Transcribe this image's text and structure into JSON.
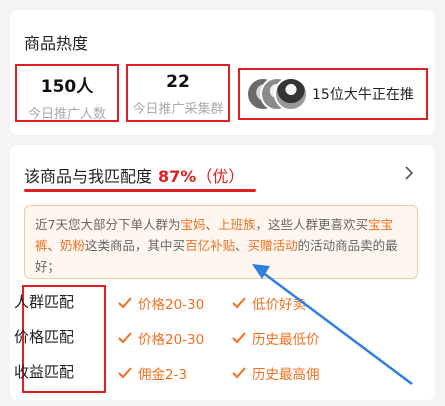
{
  "heat": {
    "title": "商品热度",
    "stats": [
      {
        "value": "150人",
        "label": "今日推广人数"
      },
      {
        "value": "22",
        "label": "今日推广采集群"
      }
    ],
    "influencer_text": "15位大牛正在推"
  },
  "match": {
    "title": "该商品与我匹配度",
    "percent": "87%",
    "rating": "（优）",
    "insight": {
      "t1": "近7天您大部分下单人群为",
      "h1": "宝妈",
      "t2": "、",
      "h2": "上班族",
      "t3": "，这些人群更喜欢买",
      "h3": "宝宝裤",
      "t4": "、",
      "h4": "奶粉",
      "t5": "这类商品，其中买",
      "h5": "百亿补贴",
      "t6": "、",
      "h6": "买赠活动",
      "t7": "的活动商品卖的最好；"
    },
    "rows": [
      {
        "label": "人群匹配",
        "tags": [
          "价格20-30",
          "低价好卖"
        ]
      },
      {
        "label": "价格匹配",
        "tags": [
          "价格20-30",
          "历史最低价"
        ]
      },
      {
        "label": "收益匹配",
        "tags": [
          "佣金2-3",
          "历史最高佣"
        ]
      }
    ]
  },
  "colors": {
    "accent_red": "#e02020",
    "highlight_orange": "#f07020",
    "annotation_blue": "#2f7fe0"
  }
}
